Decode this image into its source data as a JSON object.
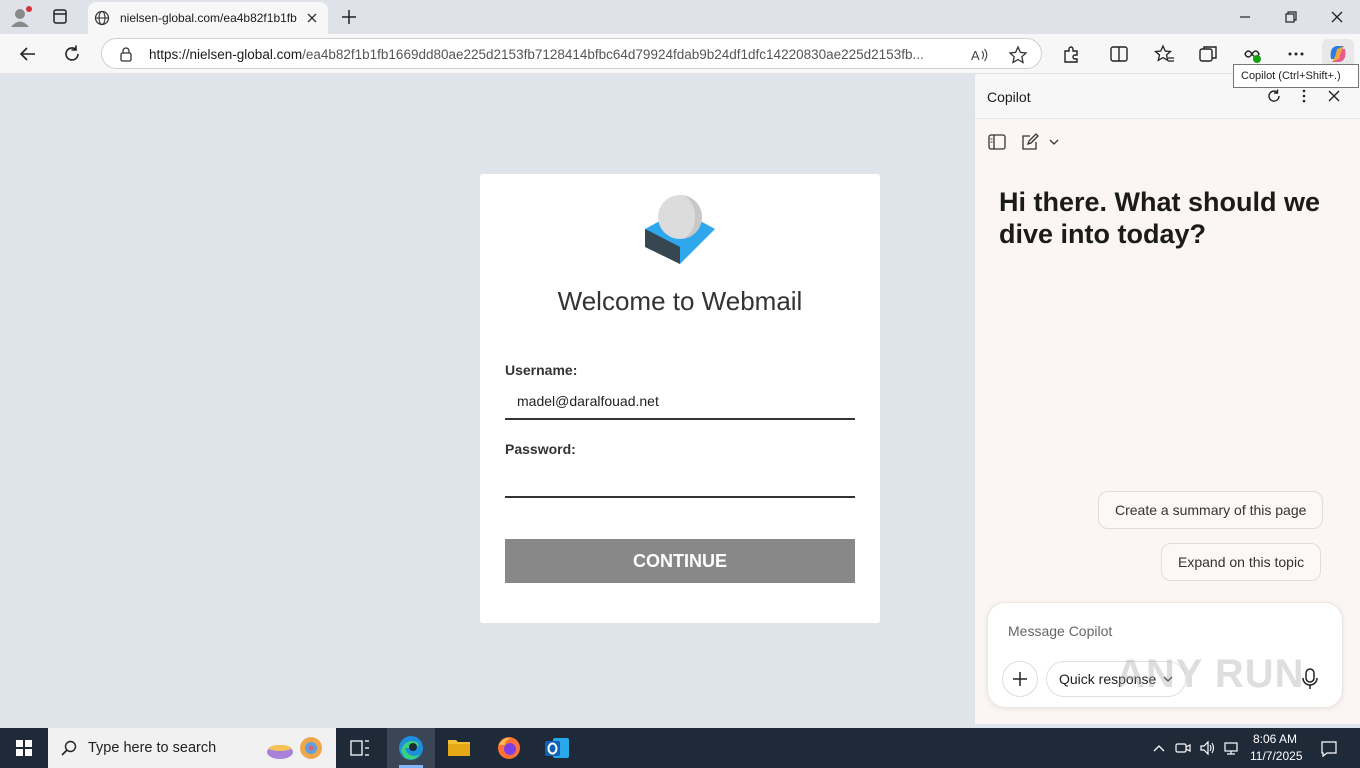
{
  "browser": {
    "tab_title": "nielsen-global.com/ea4b82f1b1fb",
    "url_host": "https://nielsen-global.com",
    "url_path": "/ea4b82f1b1fb1669dd80ae225d2153fb7128414bfbc64d79924fdab9b24df1dfc14220830ae225d2153fb...",
    "tooltip": "Copilot (Ctrl+Shift+.)"
  },
  "login": {
    "title": "Welcome to Webmail",
    "username_label": "Username:",
    "username_value": "madel@daralfouad.net",
    "password_label": "Password:",
    "password_value": "",
    "continue_label": "CONTINUE"
  },
  "copilot": {
    "title": "Copilot",
    "greeting": "Hi there. What should we dive into today?",
    "suggestions": [
      "Create a summary of this page",
      "Expand on this topic"
    ],
    "composer_placeholder": "Message Copilot",
    "mode_label": "Quick response",
    "watermark": "ANY RUN"
  },
  "taskbar": {
    "search_placeholder": "Type here to search",
    "time": "8:06 AM",
    "date": "11/7/2025"
  },
  "colors": {
    "page_bg": "#dfe3ea",
    "button_gray": "#888888",
    "taskbar": "#1f2a38",
    "logo_dark": "#37474f",
    "logo_blue": "#2fa7ec"
  }
}
